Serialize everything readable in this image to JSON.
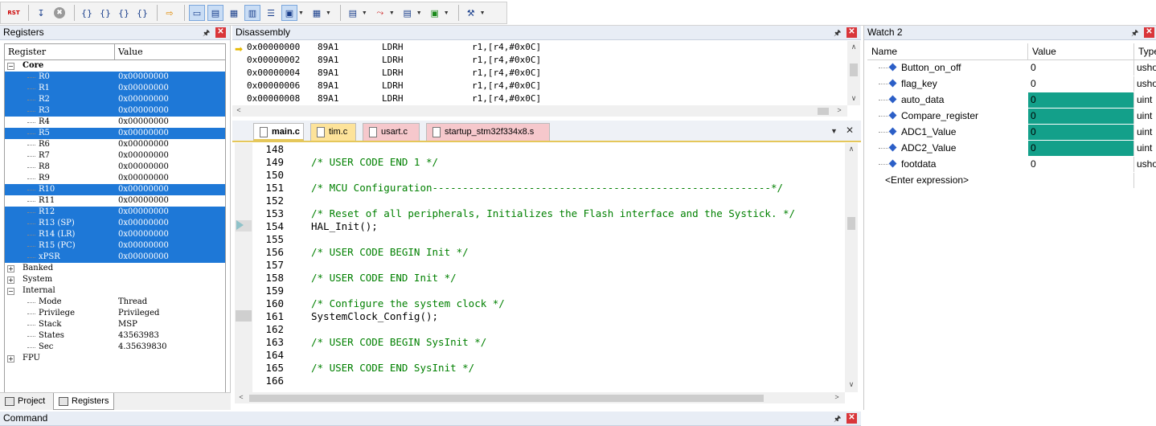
{
  "toolbar": {
    "buttons": [
      "reset-icon",
      "step-to-cursor-icon",
      "stop-icon",
      "step-into-icon",
      "step-over-icon",
      "step-out-icon",
      "run-to-cursor-icon",
      "show-next-icon",
      "command-window-icon",
      "disassembly-window-icon",
      "symbols-window-icon",
      "registers-window-icon",
      "call-stack-icon",
      "watch-window-icon",
      "memory-window-icon",
      "serial-window-icon",
      "analysis-window-icon",
      "trace-icon",
      "system-viewer-icon",
      "toolbox-icon"
    ],
    "glyphs": {
      "reset": "RST",
      "step_into": "{}",
      "step_over": "{}",
      "step_out": "{}",
      "run_to": "{}"
    }
  },
  "registers": {
    "title": "Registers",
    "col_register": "Register",
    "col_value": "Value",
    "core_label": "Core",
    "core": [
      {
        "name": "R0",
        "value": "0x00000000",
        "sel": true
      },
      {
        "name": "R1",
        "value": "0x00000000",
        "sel": true
      },
      {
        "name": "R2",
        "value": "0x00000000",
        "sel": true
      },
      {
        "name": "R3",
        "value": "0x00000000",
        "sel": true
      },
      {
        "name": "R4",
        "value": "0x00000000",
        "sel": false
      },
      {
        "name": "R5",
        "value": "0x00000000",
        "sel": true
      },
      {
        "name": "R6",
        "value": "0x00000000",
        "sel": false
      },
      {
        "name": "R7",
        "value": "0x00000000",
        "sel": false
      },
      {
        "name": "R8",
        "value": "0x00000000",
        "sel": false
      },
      {
        "name": "R9",
        "value": "0x00000000",
        "sel": false
      },
      {
        "name": "R10",
        "value": "0x00000000",
        "sel": true
      },
      {
        "name": "R11",
        "value": "0x00000000",
        "sel": false
      },
      {
        "name": "R12",
        "value": "0x00000000",
        "sel": true
      },
      {
        "name": "R13 (SP)",
        "value": "0x00000000",
        "sel": true
      },
      {
        "name": "R14 (LR)",
        "value": "0x00000000",
        "sel": true
      },
      {
        "name": "R15 (PC)",
        "value": "0x00000000",
        "sel": true
      },
      {
        "name": "xPSR",
        "value": "0x00000000",
        "sel": true
      }
    ],
    "groups": {
      "banked": "Banked",
      "system": "System",
      "internal": "Internal",
      "fpu": "FPU"
    },
    "internal": [
      {
        "name": "Mode",
        "value": "Thread"
      },
      {
        "name": "Privilege",
        "value": "Privileged"
      },
      {
        "name": "Stack",
        "value": "MSP"
      },
      {
        "name": "States",
        "value": "43563983"
      },
      {
        "name": "Sec",
        "value": "4.35639830"
      }
    ],
    "tabs": {
      "project": "Project",
      "registers": "Registers"
    }
  },
  "disassembly": {
    "title": "Disassembly",
    "lines": [
      {
        "addr": "0x00000000",
        "hex": "89A1",
        "op": "LDRH",
        "args": "r1,[r4,#0x0C]"
      },
      {
        "addr": "0x00000002",
        "hex": "89A1",
        "op": "LDRH",
        "args": "r1,[r4,#0x0C]"
      },
      {
        "addr": "0x00000004",
        "hex": "89A1",
        "op": "LDRH",
        "args": "r1,[r4,#0x0C]"
      },
      {
        "addr": "0x00000006",
        "hex": "89A1",
        "op": "LDRH",
        "args": "r1,[r4,#0x0C]"
      },
      {
        "addr": "0x00000008",
        "hex": "89A1",
        "op": "LDRH",
        "args": "r1,[r4,#0x0C]"
      }
    ]
  },
  "editor": {
    "tabs": [
      {
        "label": "main.c",
        "color": "#ffffff",
        "active": true
      },
      {
        "label": "tim.c",
        "color": "#fde39a",
        "active": false
      },
      {
        "label": "usart.c",
        "color": "#f6c8cc",
        "active": false
      },
      {
        "label": "startup_stm32f334x8.s",
        "color": "#f6c8cc",
        "active": false
      }
    ],
    "lines": [
      {
        "n": "148",
        "code": "",
        "comment": false
      },
      {
        "n": "149",
        "code": "/* USER CODE END 1 */",
        "comment": true
      },
      {
        "n": "150",
        "code": "",
        "comment": false
      },
      {
        "n": "151",
        "code": "/* MCU Configuration--------------------------------------------------------*/",
        "comment": true
      },
      {
        "n": "152",
        "code": "",
        "comment": false
      },
      {
        "n": "153",
        "code": "/* Reset of all peripherals, Initializes the Flash interface and the Systick. */",
        "comment": true
      },
      {
        "n": "154",
        "code": "HAL_Init();",
        "comment": false
      },
      {
        "n": "155",
        "code": "",
        "comment": false
      },
      {
        "n": "156",
        "code": "/* USER CODE BEGIN Init */",
        "comment": true
      },
      {
        "n": "157",
        "code": "",
        "comment": false
      },
      {
        "n": "158",
        "code": "/* USER CODE END Init */",
        "comment": true
      },
      {
        "n": "159",
        "code": "",
        "comment": false
      },
      {
        "n": "160",
        "code": "/* Configure the system clock */",
        "comment": true
      },
      {
        "n": "161",
        "code": "SystemClock_Config();",
        "comment": false
      },
      {
        "n": "162",
        "code": "",
        "comment": false
      },
      {
        "n": "163",
        "code": "/* USER CODE BEGIN SysInit */",
        "comment": true
      },
      {
        "n": "164",
        "code": "",
        "comment": false
      },
      {
        "n": "165",
        "code": "/* USER CODE END SysInit */",
        "comment": true
      },
      {
        "n": "166",
        "code": "",
        "comment": false
      }
    ]
  },
  "watch": {
    "title": "Watch 2",
    "col_name": "Name",
    "col_value": "Value",
    "col_type": "Type",
    "rows": [
      {
        "name": "Button_on_off",
        "value": "0",
        "type": "ushort",
        "changed": false
      },
      {
        "name": "flag_key",
        "value": "0",
        "type": "ushort",
        "changed": false
      },
      {
        "name": "auto_data",
        "value": "0",
        "type": "uint",
        "changed": true
      },
      {
        "name": "Compare_register",
        "value": "0",
        "type": "uint",
        "changed": true
      },
      {
        "name": "ADC1_Value",
        "value": "0",
        "type": "uint",
        "changed": true
      },
      {
        "name": "ADC2_Value",
        "value": "0",
        "type": "uint",
        "changed": true
      },
      {
        "name": "footdata",
        "value": "0",
        "type": "ushort",
        "changed": false
      }
    ],
    "enter_expression": "<Enter expression>"
  },
  "command": {
    "title": "Command"
  },
  "colors": {
    "selection": "#1e78d7",
    "changed": "#13a08a",
    "comment": "#008000"
  }
}
